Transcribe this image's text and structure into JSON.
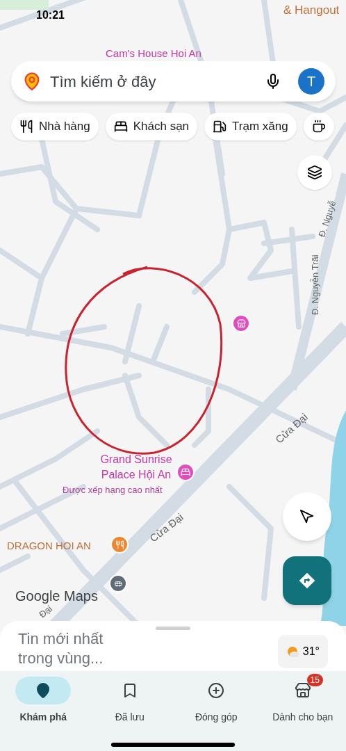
{
  "status_bar": {
    "time": "10:21"
  },
  "search": {
    "placeholder": "Tìm kiếm ở đây",
    "avatar": "T"
  },
  "chips": [
    {
      "label": "Nhà hàng"
    },
    {
      "label": "Khách sạn"
    },
    {
      "label": "Trạm xăng"
    }
  ],
  "map": {
    "labels": [
      {
        "kind": "business",
        "text": "& Hangout"
      },
      {
        "kind": "hotel",
        "text": "Cam's House Hoi An"
      },
      {
        "kind": "road",
        "text": "Đ. Nguyễn Trãi"
      },
      {
        "kind": "road",
        "text": "Đ. Nguyễ"
      },
      {
        "kind": "hotel",
        "text": "Grand Sunrise Palace Hội An"
      },
      {
        "kind": "note",
        "text": "Được xếp hạng cao nhất"
      },
      {
        "kind": "road",
        "text": "Cửa Đại"
      },
      {
        "kind": "road",
        "text": "Cửa Đại"
      },
      {
        "kind": "business",
        "text": "DRAGON HOI AN"
      },
      {
        "kind": "road",
        "text": "Đại"
      }
    ],
    "logo": "Google Maps"
  },
  "sheet": {
    "title": "Tin mới nhất trong vùng...",
    "weather": "31°"
  },
  "nav": [
    {
      "label": "Khám phá",
      "selected": true
    },
    {
      "label": "Đã lưu",
      "selected": false
    },
    {
      "label": "Đóng góp",
      "selected": false
    },
    {
      "label": "Dành cho bạn",
      "selected": false,
      "badge": "15"
    }
  ]
}
